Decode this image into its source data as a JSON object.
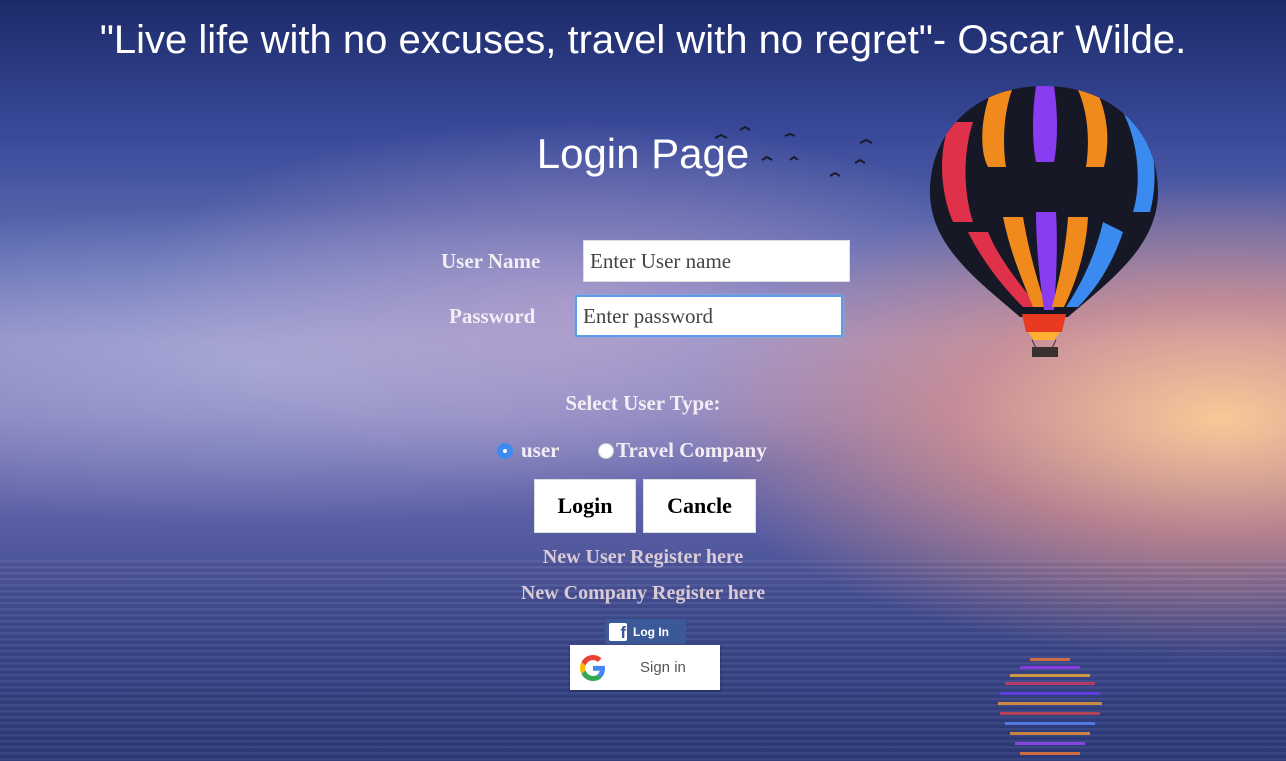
{
  "quote": "\"Live life with no excuses, travel with no regret\"- Oscar Wilde.",
  "title": "Login Page",
  "form": {
    "username_label": "User Name",
    "username_placeholder": "Enter User name",
    "password_label": "Password",
    "password_placeholder": "Enter password",
    "select_type_label": "Select User Type:",
    "user_types": [
      {
        "label": "user",
        "selected": true
      },
      {
        "label": "Travel Company",
        "selected": false
      }
    ],
    "login_label": "Login",
    "cancel_label": "Cancle"
  },
  "links": {
    "new_user": "New User Register here",
    "new_company": "New Company Register here"
  },
  "social": {
    "facebook_label": "Log In",
    "google_label": "Sign in"
  },
  "colors": {
    "accent": "#3d8bf0",
    "facebook": "#3b5998"
  },
  "icons": {
    "facebook": "facebook-icon",
    "google": "google-icon",
    "balloon": "hot-air-balloon-image",
    "birds": "birds-image"
  }
}
